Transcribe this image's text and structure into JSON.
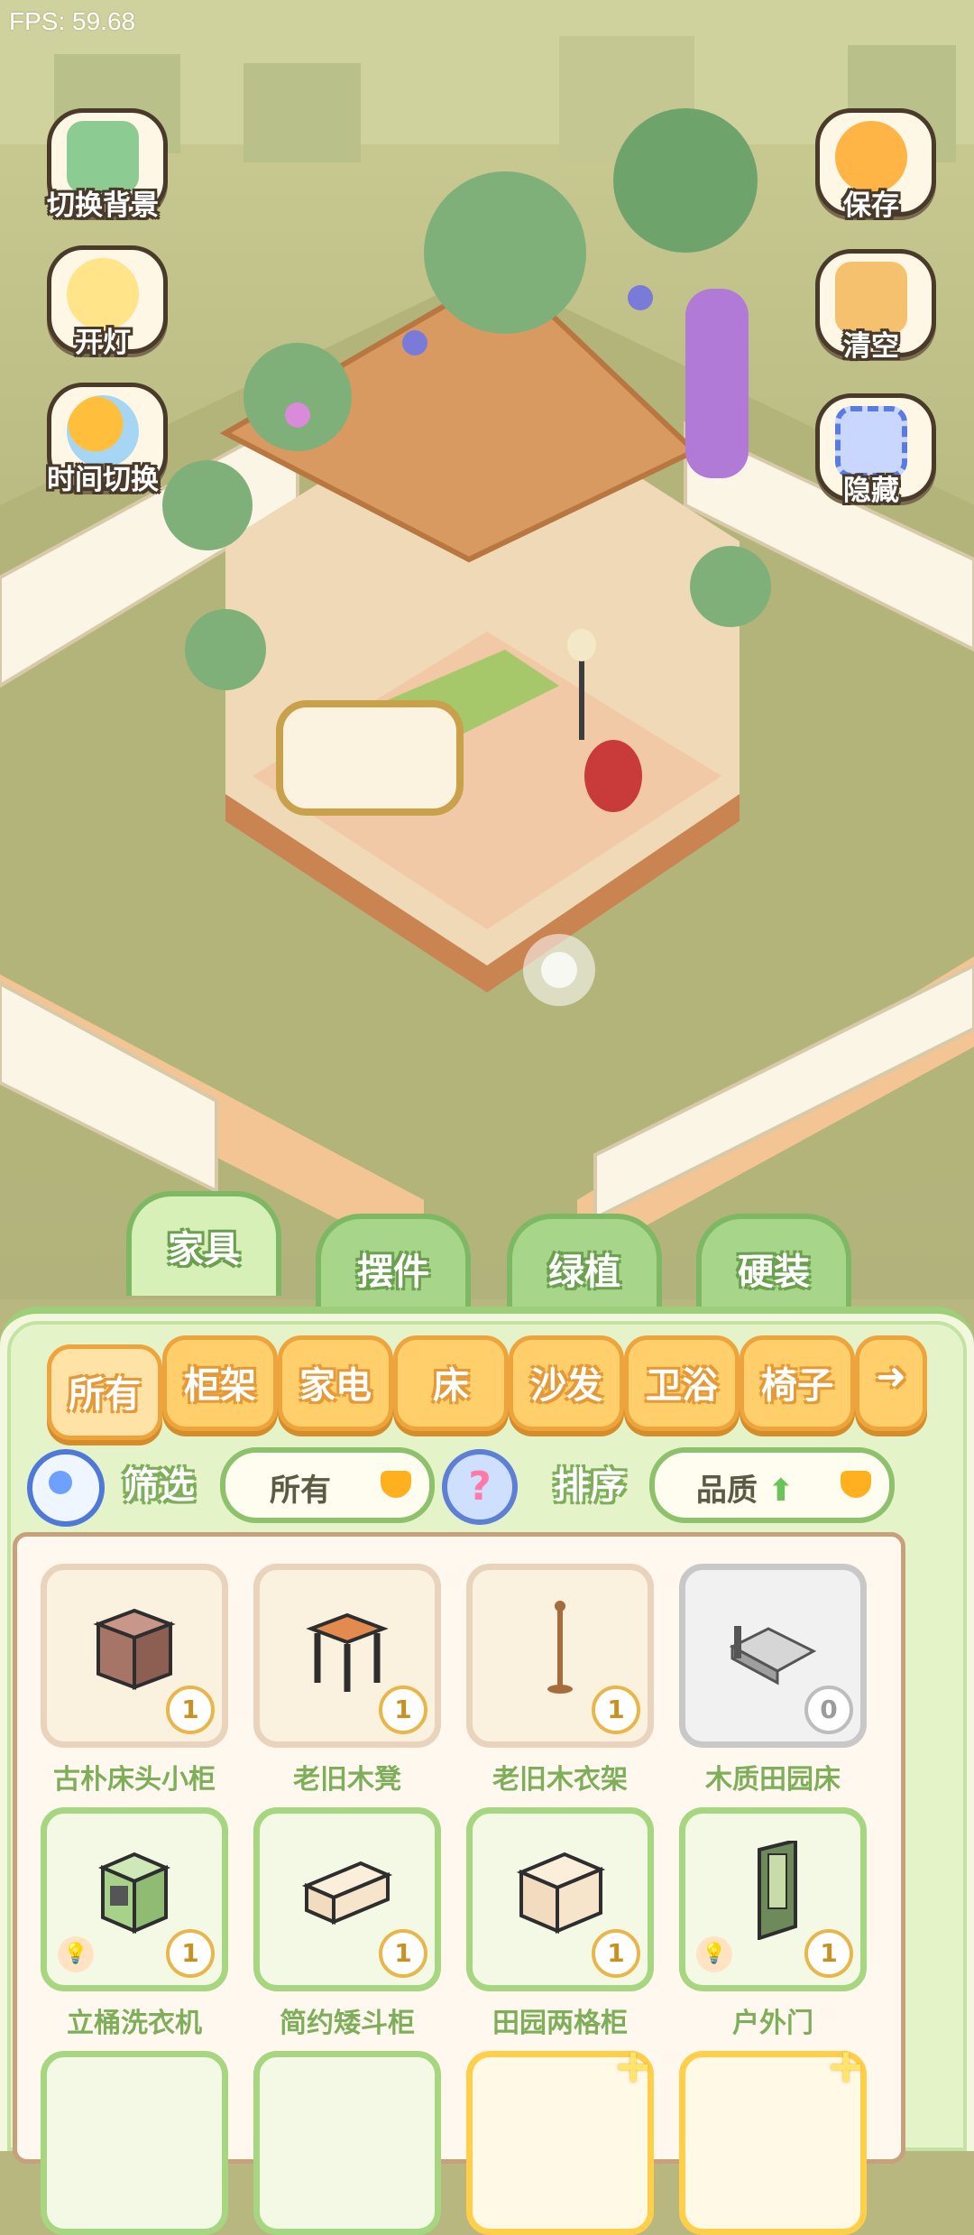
{
  "hud": {
    "fps": "FPS: 59.68"
  },
  "left_buttons": [
    {
      "label": "切换背景",
      "icon": "wallpaper-icon"
    },
    {
      "label": "开灯",
      "icon": "lamp-icon"
    },
    {
      "label": "时间切换",
      "icon": "sun-time-icon"
    }
  ],
  "right_buttons": [
    {
      "label": "保存",
      "icon": "mascot-save-icon"
    },
    {
      "label": "清空",
      "icon": "mascot-clear-icon"
    },
    {
      "label": "隐藏",
      "icon": "hide-frame-icon"
    }
  ],
  "tabs": [
    {
      "label": "家具",
      "active": true
    },
    {
      "label": "摆件",
      "active": false
    },
    {
      "label": "绿植",
      "active": false
    },
    {
      "label": "硬装",
      "active": false
    }
  ],
  "categories": [
    "所有",
    "柜架",
    "家电",
    "床",
    "沙发",
    "卫浴",
    "椅子"
  ],
  "filter": {
    "label": "筛选",
    "value": "所有"
  },
  "sort": {
    "label": "排序",
    "value": "品质"
  },
  "items": [
    {
      "name": "古朴床头小柜",
      "count": "1",
      "style": "plain",
      "thumb": "nightstand-icon"
    },
    {
      "name": "老旧木凳",
      "count": "1",
      "style": "plain",
      "thumb": "stool-icon"
    },
    {
      "name": "老旧木衣架",
      "count": "1",
      "style": "plain",
      "thumb": "coat-rack-icon"
    },
    {
      "name": "木质田园床",
      "count": "0",
      "style": "grey",
      "thumb": "bed-icon"
    },
    {
      "name": "立桶洗衣机",
      "count": "1",
      "style": "green",
      "thumb": "washing-machine-icon",
      "bulb": true
    },
    {
      "name": "简约矮斗柜",
      "count": "1",
      "style": "green",
      "thumb": "low-cabinet-icon"
    },
    {
      "name": "田园两格柜",
      "count": "1",
      "style": "green",
      "thumb": "two-door-cabinet-icon"
    },
    {
      "name": "户外门",
      "count": "1",
      "style": "green",
      "thumb": "door-icon",
      "bulb": true
    }
  ],
  "partial_items": [
    {
      "style": "green"
    },
    {
      "style": "green"
    },
    {
      "style": "gold"
    },
    {
      "style": "gold"
    }
  ]
}
